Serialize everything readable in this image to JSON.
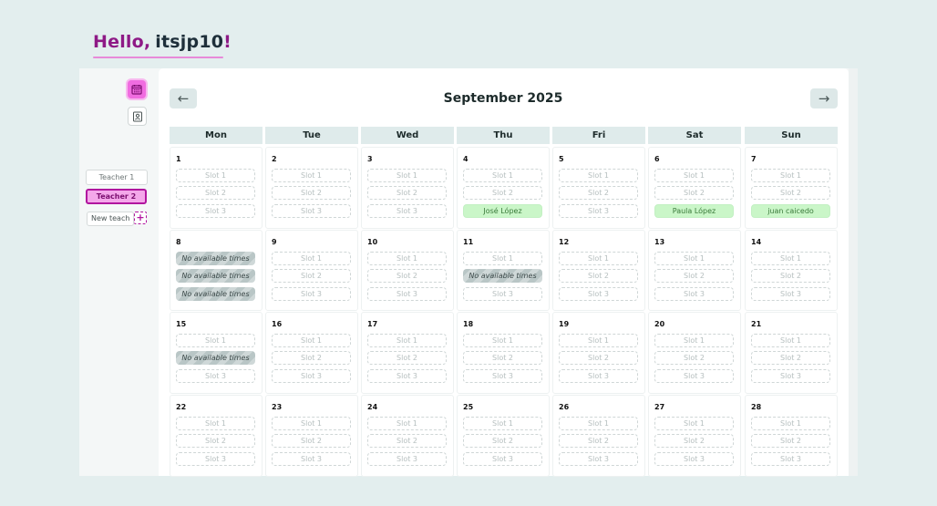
{
  "greeting": {
    "hello": "Hello,",
    "name": "itsjp10",
    "bang": "!"
  },
  "sidebar": {
    "icons": [
      {
        "name": "calendar-icon",
        "active": true
      },
      {
        "name": "contact-icon",
        "active": false
      }
    ],
    "teachers": [
      {
        "label": "Teacher 1",
        "selected": false
      },
      {
        "label": "Teacher 2",
        "selected": true
      }
    ],
    "new_teacher_value": "New teach",
    "add_label": "+"
  },
  "calendar": {
    "prev_label": "←",
    "next_label": "→",
    "month_title": "September 2025",
    "weekdays": [
      "Mon",
      "Tue",
      "Wed",
      "Thu",
      "Fri",
      "Sat",
      "Sun"
    ],
    "weeks": [
      [
        {
          "day": "1",
          "slots": [
            "Slot 1",
            "Slot 2",
            "Slot 3"
          ],
          "states": [
            "empty",
            "empty",
            "empty"
          ]
        },
        {
          "day": "2",
          "slots": [
            "Slot 1",
            "Slot 2",
            "Slot 3"
          ],
          "states": [
            "empty",
            "empty",
            "empty"
          ]
        },
        {
          "day": "3",
          "slots": [
            "Slot 1",
            "Slot 2",
            "Slot 3"
          ],
          "states": [
            "empty",
            "empty",
            "empty"
          ]
        },
        {
          "day": "4",
          "slots": [
            "Slot 1",
            "Slot 2",
            "José López"
          ],
          "states": [
            "empty",
            "empty",
            "booked"
          ]
        },
        {
          "day": "5",
          "slots": [
            "Slot 1",
            "Slot 2",
            "Slot 3"
          ],
          "states": [
            "empty",
            "empty",
            "empty"
          ]
        },
        {
          "day": "6",
          "slots": [
            "Slot 1",
            "Slot 2",
            "Paula López"
          ],
          "states": [
            "empty",
            "empty",
            "booked"
          ]
        },
        {
          "day": "7",
          "slots": [
            "Slot 1",
            "Slot 2",
            "juan caicedo"
          ],
          "states": [
            "empty",
            "empty",
            "booked"
          ]
        }
      ],
      [
        {
          "day": "8",
          "slots": [
            "No available times",
            "No available times",
            "No available times"
          ],
          "states": [
            "na",
            "na",
            "na"
          ]
        },
        {
          "day": "9",
          "slots": [
            "Slot 1",
            "Slot 2",
            "Slot 3"
          ],
          "states": [
            "empty",
            "empty",
            "empty"
          ]
        },
        {
          "day": "10",
          "slots": [
            "Slot 1",
            "Slot 2",
            "Slot 3"
          ],
          "states": [
            "empty",
            "empty",
            "empty"
          ]
        },
        {
          "day": "11",
          "slots": [
            "Slot 1",
            "No available times",
            "Slot 3"
          ],
          "states": [
            "empty",
            "na",
            "empty"
          ]
        },
        {
          "day": "12",
          "slots": [
            "Slot 1",
            "Slot 2",
            "Slot 3"
          ],
          "states": [
            "empty",
            "empty",
            "empty"
          ]
        },
        {
          "day": "13",
          "slots": [
            "Slot 1",
            "Slot 2",
            "Slot 3"
          ],
          "states": [
            "empty",
            "empty",
            "empty"
          ]
        },
        {
          "day": "14",
          "slots": [
            "Slot 1",
            "Slot 2",
            "Slot 3"
          ],
          "states": [
            "empty",
            "empty",
            "empty"
          ]
        }
      ],
      [
        {
          "day": "15",
          "slots": [
            "Slot 1",
            "No available times",
            "Slot 3"
          ],
          "states": [
            "empty",
            "na",
            "empty"
          ]
        },
        {
          "day": "16",
          "slots": [
            "Slot 1",
            "Slot 2",
            "Slot 3"
          ],
          "states": [
            "empty",
            "empty",
            "empty"
          ]
        },
        {
          "day": "17",
          "slots": [
            "Slot 1",
            "Slot 2",
            "Slot 3"
          ],
          "states": [
            "empty",
            "empty",
            "empty"
          ]
        },
        {
          "day": "18",
          "slots": [
            "Slot 1",
            "Slot 2",
            "Slot 3"
          ],
          "states": [
            "empty",
            "empty",
            "empty"
          ]
        },
        {
          "day": "19",
          "slots": [
            "Slot 1",
            "Slot 2",
            "Slot 3"
          ],
          "states": [
            "empty",
            "empty",
            "empty"
          ]
        },
        {
          "day": "20",
          "slots": [
            "Slot 1",
            "Slot 2",
            "Slot 3"
          ],
          "states": [
            "empty",
            "empty",
            "empty"
          ]
        },
        {
          "day": "21",
          "slots": [
            "Slot 1",
            "Slot 2",
            "Slot 3"
          ],
          "states": [
            "empty",
            "empty",
            "empty"
          ]
        }
      ],
      [
        {
          "day": "22",
          "slots": [
            "Slot 1",
            "Slot 2",
            "Slot 3"
          ],
          "states": [
            "empty",
            "empty",
            "empty"
          ]
        },
        {
          "day": "23",
          "slots": [
            "Slot 1",
            "Slot 2",
            "Slot 3"
          ],
          "states": [
            "empty",
            "empty",
            "empty"
          ]
        },
        {
          "day": "24",
          "slots": [
            "Slot 1",
            "Slot 2",
            "Slot 3"
          ],
          "states": [
            "empty",
            "empty",
            "empty"
          ]
        },
        {
          "day": "25",
          "slots": [
            "Slot 1",
            "Slot 2",
            "Slot 3"
          ],
          "states": [
            "empty",
            "empty",
            "empty"
          ]
        },
        {
          "day": "26",
          "slots": [
            "Slot 1",
            "Slot 2",
            "Slot 3"
          ],
          "states": [
            "empty",
            "empty",
            "empty"
          ]
        },
        {
          "day": "27",
          "slots": [
            "Slot 1",
            "Slot 2",
            "Slot 3"
          ],
          "states": [
            "empty",
            "empty",
            "empty"
          ]
        },
        {
          "day": "28",
          "slots": [
            "Slot 1",
            "Slot 2",
            "Slot 3"
          ],
          "states": [
            "empty",
            "empty",
            "empty"
          ]
        }
      ]
    ]
  },
  "colors": {
    "accent": "#b1159f",
    "accent_light": "#f06ce0",
    "booked_bg": "#caf6c8",
    "page_bg": "#e3eeee"
  }
}
